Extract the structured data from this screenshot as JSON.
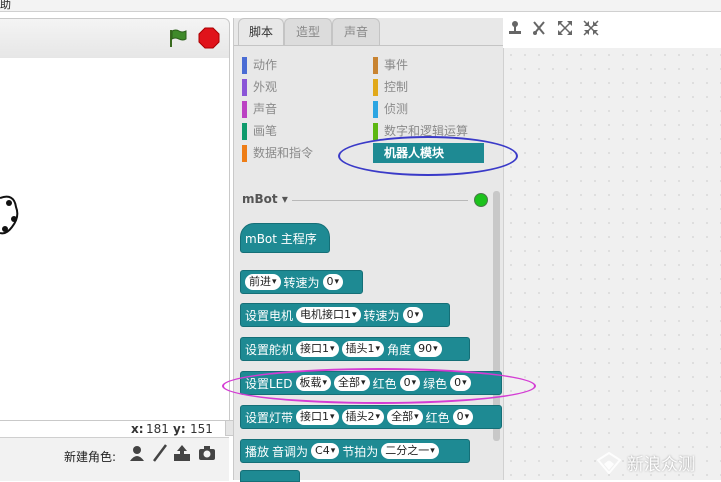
{
  "menu": {
    "partial_label": "助"
  },
  "stage": {
    "coords": {
      "x_label": "x:",
      "x_value": "181",
      "y_label": "y:",
      "y_value": "151"
    },
    "new_sprite_label": "新建角色:"
  },
  "palette": {
    "tabs": [
      {
        "label": "脚本",
        "active": true
      },
      {
        "label": "造型",
        "active": false
      },
      {
        "label": "声音",
        "active": false
      }
    ],
    "categories": [
      {
        "label": "动作",
        "color": "#4a6cd4"
      },
      {
        "label": "事件",
        "color": "#c88330"
      },
      {
        "label": "外观",
        "color": "#8a55d7"
      },
      {
        "label": "控制",
        "color": "#e1a91a"
      },
      {
        "label": "声音",
        "color": "#bb42c3"
      },
      {
        "label": "侦测",
        "color": "#2ca5e2"
      },
      {
        "label": "画笔",
        "color": "#0e9a6c"
      },
      {
        "label": "数字和逻辑运算",
        "color": "#5cb712"
      },
      {
        "label": "数据和指令",
        "color": "#ee7d16"
      },
      {
        "label": "机器人模块",
        "color": "#1e8a93",
        "selected": true
      }
    ],
    "section_title": "mBot",
    "blocks": {
      "main": "mBot 主程序",
      "forward": {
        "dir": "前进",
        "speed_label": "转速为",
        "speed": "0"
      },
      "motor": {
        "label": "设置电机",
        "port": "电机接口1",
        "speed_label": "转速为",
        "speed": "0"
      },
      "servo": {
        "label": "设置舵机",
        "port": "接口1",
        "slot": "插头1",
        "angle_label": "角度",
        "angle": "90"
      },
      "led": {
        "label": "设置LED",
        "where": "板载",
        "which": "全部",
        "red_label": "红色",
        "red": "0",
        "green_label": "绿色",
        "green": "0"
      },
      "strip": {
        "label": "设置灯带",
        "port": "接口1",
        "slot": "插头2",
        "which": "全部",
        "red_label": "红色",
        "red": "0"
      },
      "play": {
        "label": "播放",
        "tone_label": "音调为",
        "tone": "C4",
        "beat_label": "节拍为",
        "beat": "二分之一"
      }
    }
  },
  "watermark": {
    "text": "新浪众测"
  },
  "colors": {
    "robot_block": "#1e8a93",
    "annotation_blue": "#3a3ac8",
    "annotation_pink": "#d43cd4"
  }
}
